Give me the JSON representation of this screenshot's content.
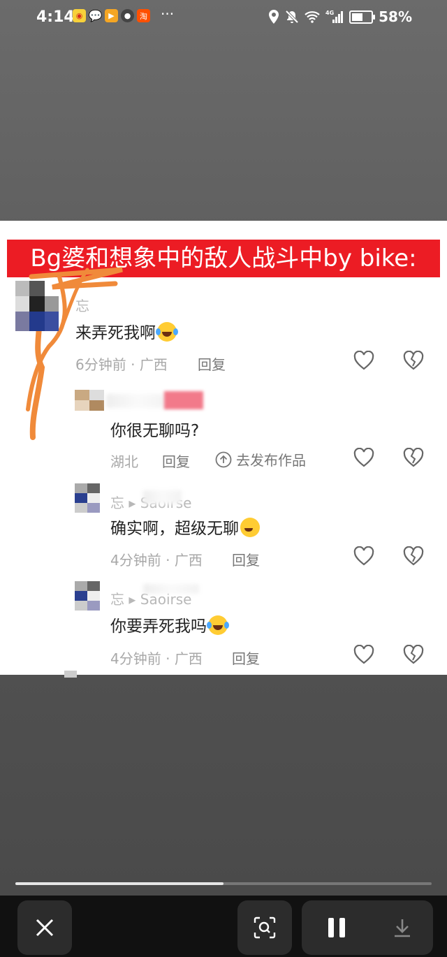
{
  "status": {
    "time": "4:14",
    "more": "···",
    "battery": "58%",
    "battery_level": 0.58,
    "network": "4G",
    "apps": [
      "weibo-icon",
      "wechat-icon",
      "video-app-icon",
      "avatar-app-icon",
      "taobao-icon"
    ]
  },
  "post": {
    "title": "Bg婆和想象中的敌人战斗中by bike:",
    "comments": [
      {
        "name": "忘",
        "text": "来弄死我啊",
        "emoji": "laugh-cry-emoji",
        "time": "6分钟前",
        "location": "广西",
        "reply": "回复"
      },
      {
        "name": "",
        "text": "你很无聊吗?",
        "emoji": "",
        "location": "湖北",
        "reply": "回复",
        "publish": "去发布作品"
      },
      {
        "name": "忘 ▸ Saoirse",
        "text": "确实啊，超级无聊",
        "emoji": "wink-tongue-emoji",
        "time": "4分钟前",
        "location": "广西",
        "reply": "回复"
      },
      {
        "name": "忘 ▸ Saoirse",
        "text": "你要弄死我吗",
        "emoji": "laugh-cry-emoji",
        "time": "4分钟前",
        "location": "广西",
        "reply": "回复"
      }
    ]
  },
  "player": {
    "progress": 0.5
  },
  "colors": {
    "title_bg": "#ec1c24",
    "background": "#5a5a5a",
    "bottom_bar": "#111111"
  }
}
